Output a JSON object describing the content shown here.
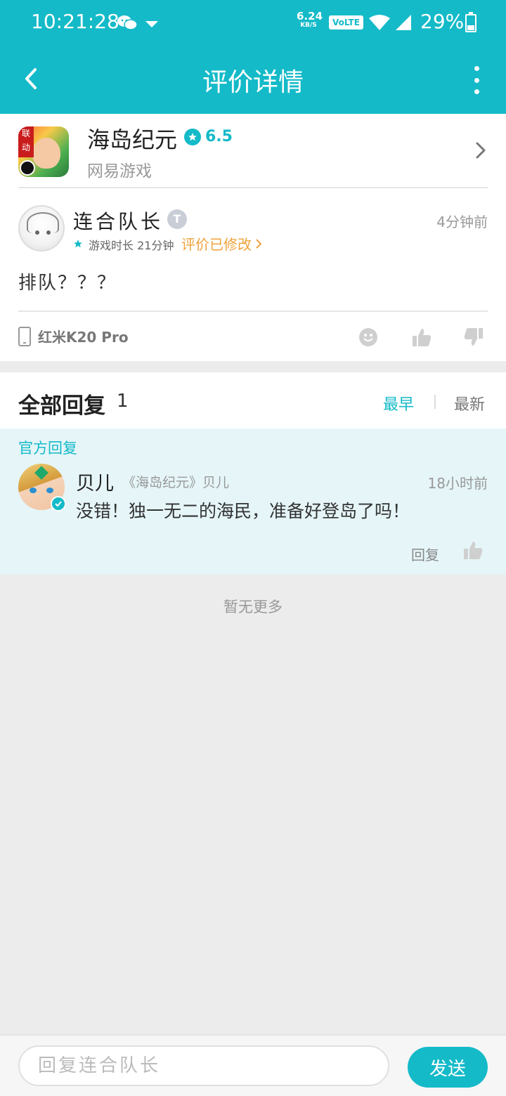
{
  "status_bar": {
    "time": "10:21:28",
    "net_speed_value": "6.24",
    "net_speed_unit": "KB/S",
    "volte": "VoLTE",
    "battery": "29%"
  },
  "nav": {
    "title": "评价详情"
  },
  "game": {
    "name": "海岛纪元",
    "rating": "6.5",
    "developer": "网易游戏",
    "icon_badge": "联动"
  },
  "review": {
    "username": "连合队长",
    "level": "T",
    "time": "4分钟前",
    "playtime": "游戏时长 21分钟",
    "edited": "评价已修改",
    "content": "排队？？？",
    "device": "红米K20 Pro"
  },
  "replies": {
    "title": "全部回复",
    "count": "1",
    "sort_earliest": "最早",
    "sort_newest": "最新"
  },
  "official_reply": {
    "label": "官方回复",
    "name": "贝儿",
    "game_tag": "《海岛纪元》贝儿",
    "time": "18小时前",
    "content": "没错！独一无二的海民，准备好登岛了吗！",
    "reply_label": "回复"
  },
  "no_more": "暂无更多",
  "bottom": {
    "placeholder": "回复连合队长",
    "send": "发送"
  },
  "colors": {
    "accent": "#14bac8",
    "edited": "#f0a33c",
    "official_bg": "#e5f5f8"
  }
}
